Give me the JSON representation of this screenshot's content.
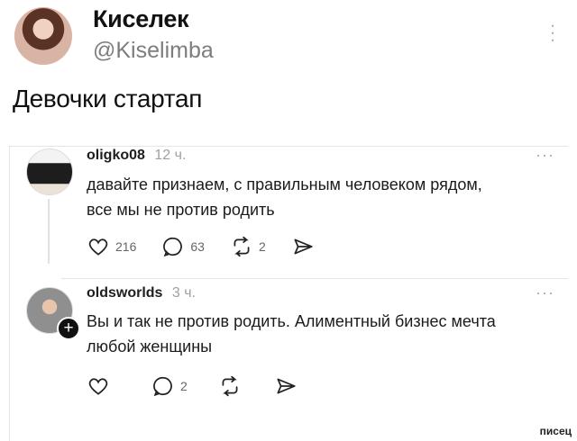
{
  "profile": {
    "name": "Киселек",
    "handle": "@Kiselimba"
  },
  "post": {
    "text": "Девочки стартап"
  },
  "replies": [
    {
      "user": "oligko08",
      "time": "12 ч.",
      "text_line1": "давайте признаем, с правильным человеком рядом,",
      "text_line2": "все мы не против родить",
      "likes": "216",
      "comments": "63",
      "reposts": "2"
    },
    {
      "user": "oldsworlds",
      "time": "3 ч.",
      "text_line1": "Вы и так не против родить. Алиментный бизнес мечта",
      "text_line2": "любой женщины",
      "comments": "2"
    }
  ],
  "ui": {
    "dots": "···"
  },
  "watermark": "писец",
  "icons": {
    "like": "heart-icon",
    "comment": "speech-bubble-icon",
    "repost": "repost-icon",
    "share": "send-icon"
  }
}
